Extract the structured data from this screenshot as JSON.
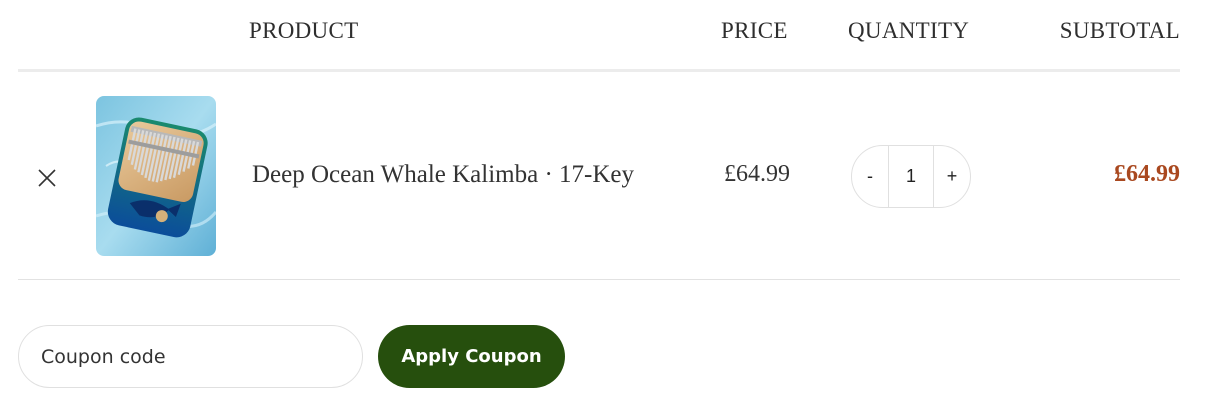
{
  "table_header": {
    "product": "PRODUCT",
    "price": "PRICE",
    "quantity": "QUANTITY",
    "subtotal": "SUBTOTAL"
  },
  "cart_items": [
    {
      "name": "Deep Ocean Whale Kalimba · 17-Key",
      "price": "£64.99",
      "quantity": "1",
      "subtotal": "£64.99",
      "remove_icon": "close-icon",
      "decrement_label": "-",
      "increment_label": "+"
    }
  ],
  "coupon": {
    "placeholder": "Coupon code",
    "value": "",
    "apply_label": "Apply Coupon"
  },
  "colors": {
    "subtotal": "#a9481f",
    "apply_button": "#264f0d",
    "border": "#e0e0e0"
  }
}
